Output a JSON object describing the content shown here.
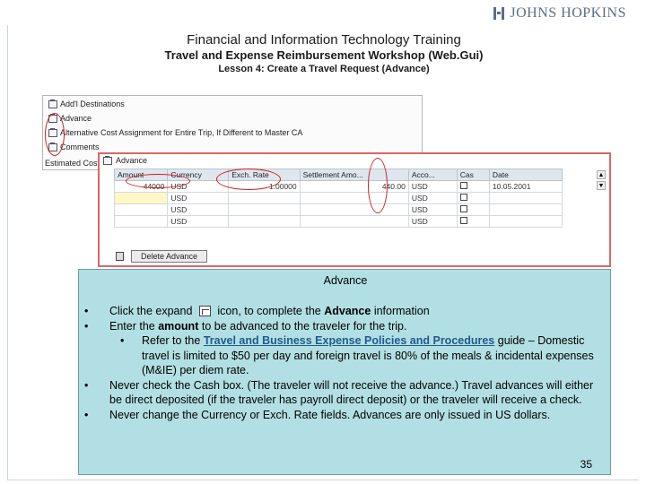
{
  "header": {
    "brand": "JOHNS HOPKINS",
    "title": "Financial and Information Technology Training",
    "subtitle": "Travel and Expense Reimbursement Workshop (Web.Gui)",
    "lesson": "Lesson 4: Create a Travel Request (Advance)"
  },
  "tree": {
    "items": [
      "Add'l Destinations",
      "Advance",
      "Alternative Cost Assignment for Entire Trip, If Different to Master CA",
      "Comments"
    ],
    "estimated_label": "Estimated Cost"
  },
  "advance_panel": {
    "header": "Advance",
    "columns": [
      "Amount",
      "Currency",
      "Exch. Rate",
      "Settlement Amo...",
      "Acco...",
      "Cas",
      "Date"
    ],
    "rows": [
      {
        "amount": "44000",
        "currency": "USD",
        "rate": "1.00000",
        "settlement": "440.00",
        "acct": "USD",
        "date": "10.05.2001"
      },
      {
        "amount": "",
        "currency": "USD",
        "rate": "",
        "settlement": "",
        "acct": "USD",
        "date": ""
      },
      {
        "amount": "",
        "currency": "USD",
        "rate": "",
        "settlement": "",
        "acct": "USD",
        "date": ""
      },
      {
        "amount": "",
        "currency": "USD",
        "rate": "",
        "settlement": "",
        "acct": "USD",
        "date": ""
      }
    ],
    "delete_label": "Delete Advance"
  },
  "info": {
    "title": "Advance",
    "b1_pre": "Click the expand",
    "b1_post": "icon, to complete the",
    "b1_bold": "Advance",
    "b1_end": "information",
    "b2_pre": "Enter the",
    "b2_bold": "amount",
    "b2_post": "to be advanced to the traveler for the trip.",
    "sub_pre": "Refer to the",
    "sub_link": "Travel and Business Expense Policies and Procedures",
    "sub_post": "guide – Domestic travel is limited to $50 per day and foreign travel is 80% of the meals & incidental expenses (M&IE) per diem rate.",
    "b3": "Never check the Cash box. (The traveler will not receive the advance.) Travel advances will either be direct deposited (if the traveler has payroll direct deposit) or the traveler will receive a check.",
    "b4": "Never change the Currency or Exch. Rate fields.  Advances are only issued in US dollars."
  },
  "page_number": "35",
  "colors": {
    "highlight_circle": "#cc2222",
    "info_bg": "#b2dfe3",
    "link": "#1e5c8a"
  }
}
